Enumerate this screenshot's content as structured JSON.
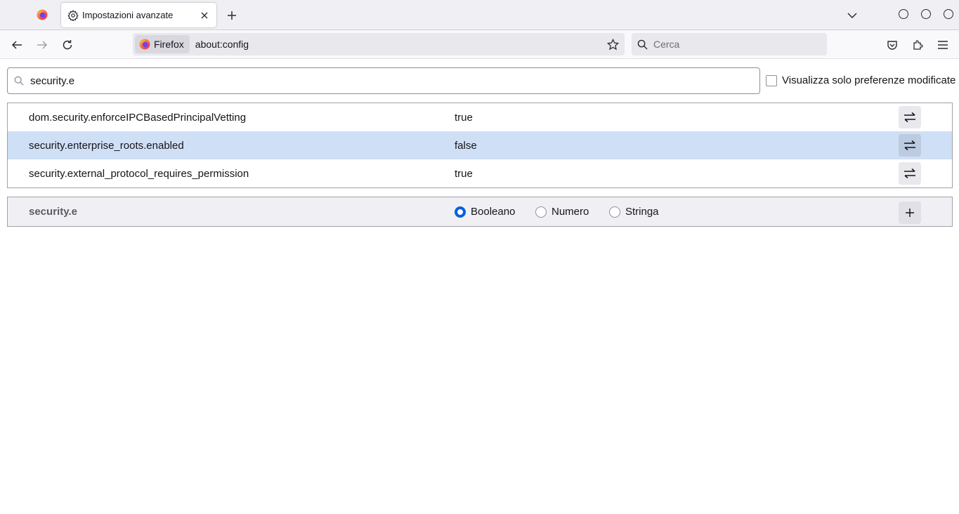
{
  "tabs": {
    "active_title": "Impostazioni avanzate"
  },
  "urlbar": {
    "identity_label": "Firefox",
    "url": "about:config"
  },
  "searchbar": {
    "placeholder": "Cerca"
  },
  "config": {
    "filter_value": "security.e",
    "show_modified_label": "Visualizza solo preferenze modificate",
    "preferences": [
      {
        "name": "dom.security.enforceIPCBasedPrincipalVetting",
        "value": "true"
      },
      {
        "name": "security.enterprise_roots.enabled",
        "value": "false"
      },
      {
        "name": "security.external_protocol_requires_permission",
        "value": "true"
      }
    ],
    "new_pref": {
      "name": "security.e",
      "types": [
        "Booleano",
        "Numero",
        "Stringa"
      ],
      "selected_type": "Booleano"
    }
  },
  "colors": {
    "selected_row": "#cfdff5",
    "radio_accent": "#0061e0"
  }
}
